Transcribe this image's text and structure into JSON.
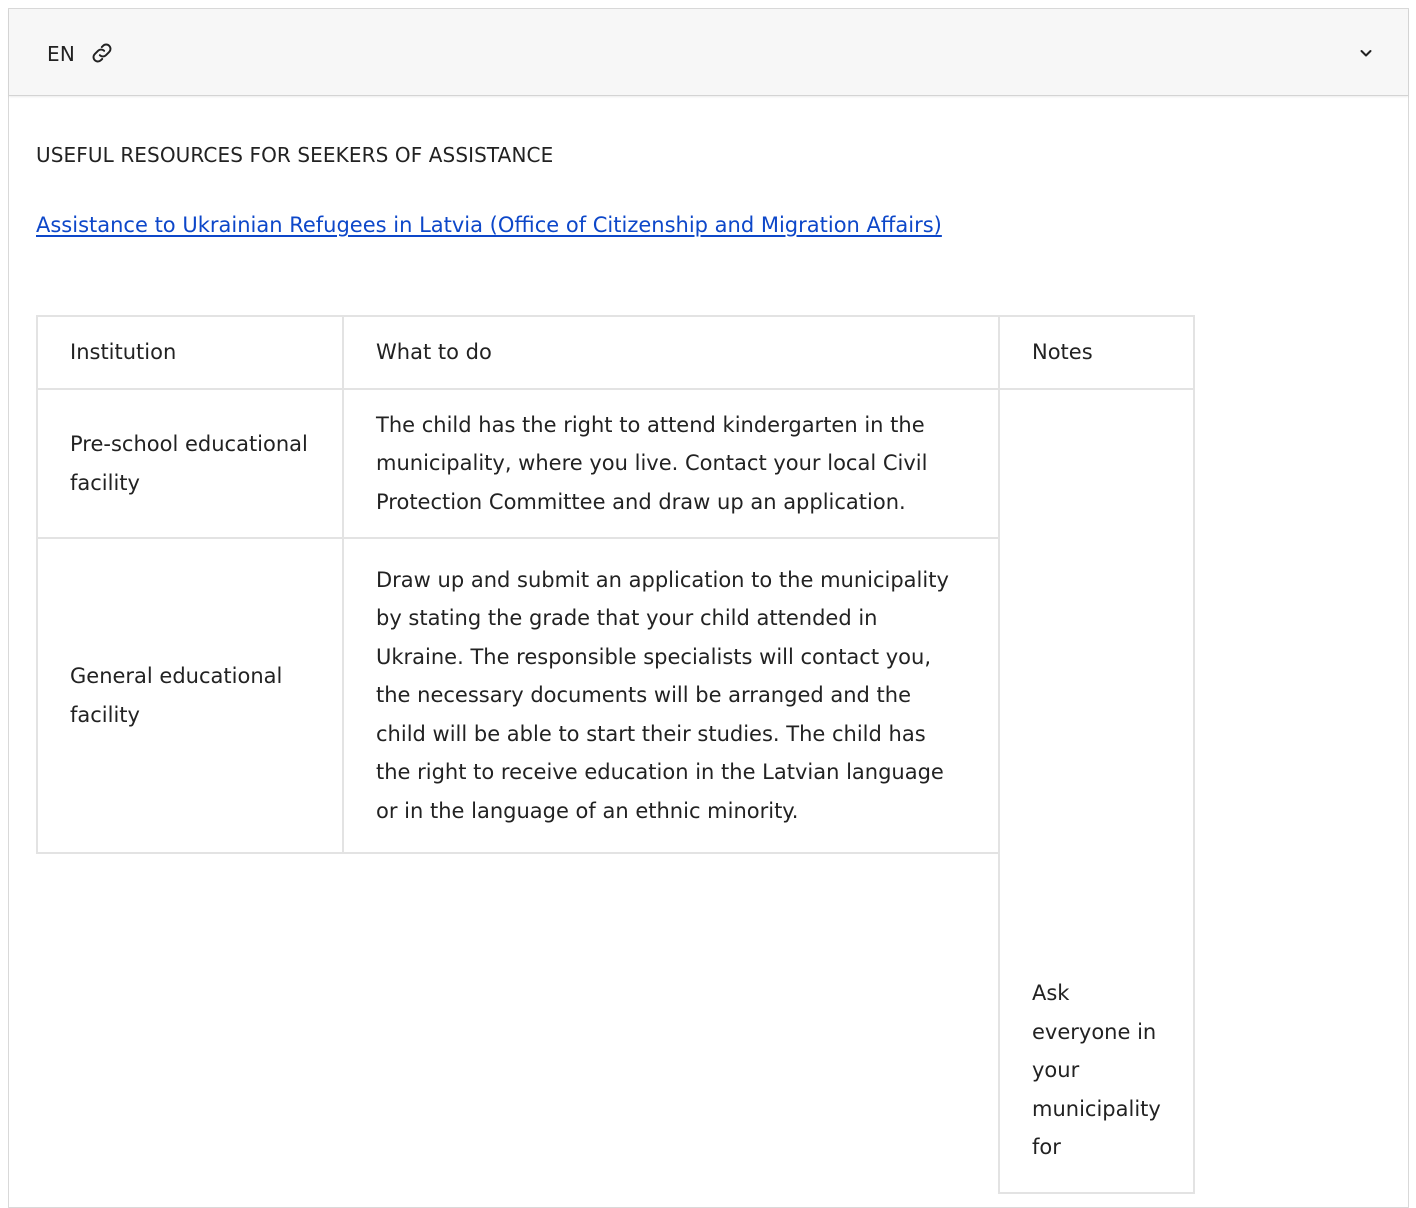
{
  "header": {
    "language": "EN",
    "link_icon": "link-icon",
    "expand_icon": "chevron-down-icon"
  },
  "content": {
    "heading": "USEFUL RESOURCES FOR SEEKERS OF ASSISTANCE",
    "link_text": "Assistance to Ukrainian Refugees in Latvia (Office of Citizenship and Migration Affairs)"
  },
  "table": {
    "headers": {
      "institution": "Institution",
      "what_to_do": "What to do",
      "notes": "Notes"
    },
    "rows": [
      {
        "institution": "Pre-school educational facility",
        "what_to_do": "The child has the right to attend kindergarten in the municipality, where you live. Contact your local Civil Protection Committee and draw up an application."
      },
      {
        "institution": "General educational facility",
        "what_to_do": "Draw up and submit an application to the municipality by stating the grade that your child attended in Ukraine. The responsible specialists will contact you, the necessary documents will be arranged and the child will be able to start their studies. The child has the right to receive education in the Latvian language or in the language of an ethnic minority."
      }
    ],
    "notes_text": "Ask everyone in your municipality for"
  },
  "colors": {
    "link": "#0d47c9",
    "header_bg": "#f7f7f7",
    "border": "#e3e3e3"
  }
}
